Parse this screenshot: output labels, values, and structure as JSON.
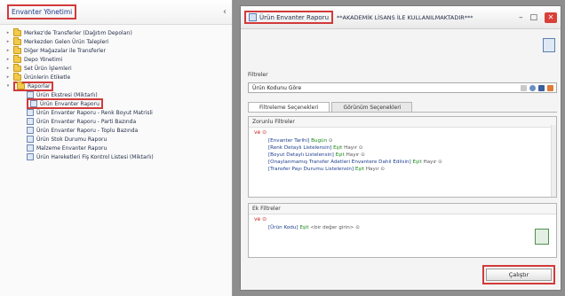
{
  "left_pane": {
    "title": "Envanter Yönetimi",
    "collapse_glyph": "‹",
    "tree": [
      {
        "label": "Merkez'de Transferler (Dağıtım Depoları)",
        "type": "folder",
        "expanded": false
      },
      {
        "label": "Merkezden Gelen Ürün Talepleri",
        "type": "folder",
        "expanded": false
      },
      {
        "label": "Diğer Mağazalar ile Transferler",
        "type": "folder",
        "expanded": false
      },
      {
        "label": "Depo Yönetimi",
        "type": "folder",
        "expanded": false
      },
      {
        "label": "Set Ürün İşlemleri",
        "type": "folder",
        "expanded": false
      },
      {
        "label": "Ürünlerin Etiketle",
        "type": "folder",
        "expanded": false
      },
      {
        "label": "Raporlar",
        "type": "folder",
        "expanded": true,
        "highlighted": true
      }
    ],
    "reports": [
      {
        "label": "Ürün Ekstresi (Miktarlı)"
      },
      {
        "label": "Ürün Envanter Raporu",
        "highlighted": true
      },
      {
        "label": "Ürün Envanter Raporu - Renk Boyut Matrisli"
      },
      {
        "label": "Ürün Envanter Raporu - Parti Bazında"
      },
      {
        "label": "Ürün Envanter Raporu - Toplu Bazında"
      },
      {
        "label": "Ürün Stok Durumu Raporu"
      },
      {
        "label": "Malzeme Envanter Raporu"
      },
      {
        "label": "Ürün Hareketleri Fiş Kontrol Listesi (Miktarlı)"
      }
    ]
  },
  "window": {
    "title": "Ürün Envanter Raporu",
    "subtitle": "**AKADEMİK LİSANS İLE KULLANILMAKTADIR***",
    "minimize": "–",
    "maximize": "□",
    "close": "✕",
    "filters_label": "Filtreler",
    "filter_select_value": "Ürün Kodunu Göre",
    "tabs": [
      "Filtreleme Seçenekleri",
      "Görünüm Seçenekleri"
    ],
    "mandatory_filters_label": "Zorunlu Filtreler",
    "ve_label": "ve ⊙",
    "conditions": [
      {
        "field": "[Envanter Tarihi]",
        "op": "Bugün",
        "val": "⊙"
      },
      {
        "field": "[Renk Detaylı Listelensin]",
        "op": "Eşit",
        "val": "Hayır ⊙"
      },
      {
        "field": "[Boyut Detaylı Listelensin]",
        "op": "Eşit",
        "val": "Hayır ⊙"
      },
      {
        "field": "[Onaylanmamış Transfer Adetleri Envantere Dahil Edilsin]",
        "op": "Eşit",
        "val": "Hayır ⊙"
      },
      {
        "field": "[Transfer Payı Durumu Listelensin]",
        "op": "Eşit",
        "val": "Hayır ⊙"
      }
    ],
    "extra_filters_label": "Ek Filtreler",
    "extra_ve_label": "ve ⊙",
    "extra_condition": {
      "field": "[Ürün Kodu]",
      "op": "Eşit",
      "val": "<bir değer girin> ⊙"
    },
    "run_button": "Çalıştır"
  },
  "colors": {
    "highlight": "#d23a3a",
    "link_blue": "#1f3f8f",
    "operator_green": "#1a8a1a"
  }
}
